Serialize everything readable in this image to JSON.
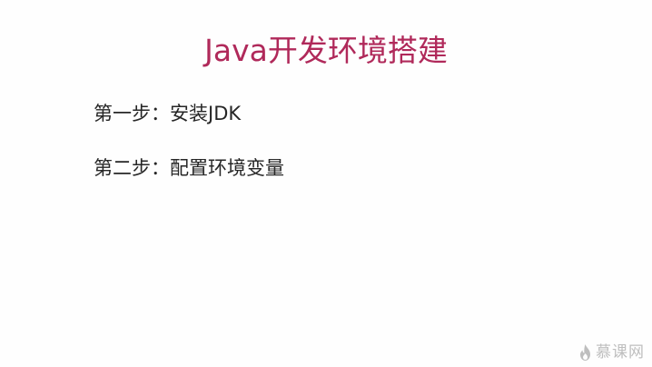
{
  "slide": {
    "title": "Java开发环境搭建",
    "steps": [
      {
        "text": "第一步：安装JDK"
      },
      {
        "text": "第二步：配置环境变量"
      }
    ]
  },
  "watermark": {
    "icon": "flame-logo-icon",
    "text": "慕课网"
  },
  "colors": {
    "title": "#b0295a",
    "body_text": "#262626",
    "background": "#fefefe",
    "watermark": "#8a8a8a"
  }
}
